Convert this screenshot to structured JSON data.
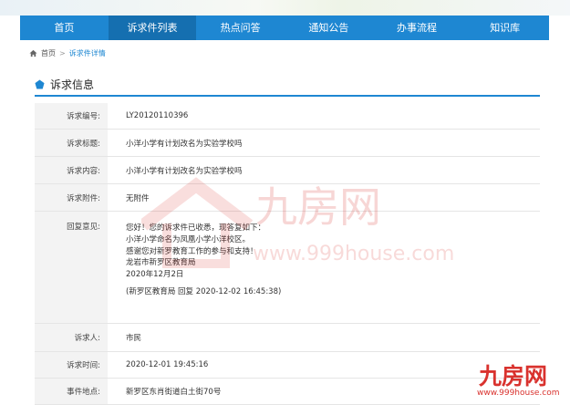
{
  "nav": {
    "items": [
      {
        "label": "首页"
      },
      {
        "label": "诉求件列表"
      },
      {
        "label": "热点问答"
      },
      {
        "label": "通知公告"
      },
      {
        "label": "办事流程"
      },
      {
        "label": "知识库"
      }
    ],
    "active_index": 1
  },
  "breadcrumb": {
    "home": "首页",
    "separator": ">",
    "current": "诉求件详情"
  },
  "section": {
    "title": "诉求信息"
  },
  "fields": {
    "number": {
      "label": "诉求编号:",
      "value": "LY20120110396"
    },
    "subject": {
      "label": "诉求标题:",
      "value": "小洋小学有计划改名为实验学校吗"
    },
    "content": {
      "label": "诉求内容:",
      "value": "小洋小学有计划改名为实验学校吗"
    },
    "attachment": {
      "label": "诉求附件:",
      "value": "无附件"
    },
    "reply": {
      "label": "回复意见:",
      "lines": [
        "您好！您的诉求件已收悉，现答复如下：",
        "小洋小学命名为凤凰小学小洋校区。",
        "感谢您对新罗教育工作的参与和支持！",
        "龙岩市新罗区教育局",
        "2020年12月2日"
      ],
      "signature": "(新罗区教育局 回复 2020-12-02 16:45:38)"
    },
    "requester": {
      "label": "诉求人:",
      "value": "市民"
    },
    "time": {
      "label": "诉求时间:",
      "value": "2020-12-01 19:45:16"
    },
    "location": {
      "label": "事件地点:",
      "value": "新罗区东肖街道白土街70号"
    }
  },
  "watermark": {
    "brand": "九房网",
    "url": "www.999house.com"
  },
  "colors": {
    "nav_bg": "#1e87d2",
    "nav_active": "#156fb0",
    "watermark_red": "#d9322e"
  }
}
